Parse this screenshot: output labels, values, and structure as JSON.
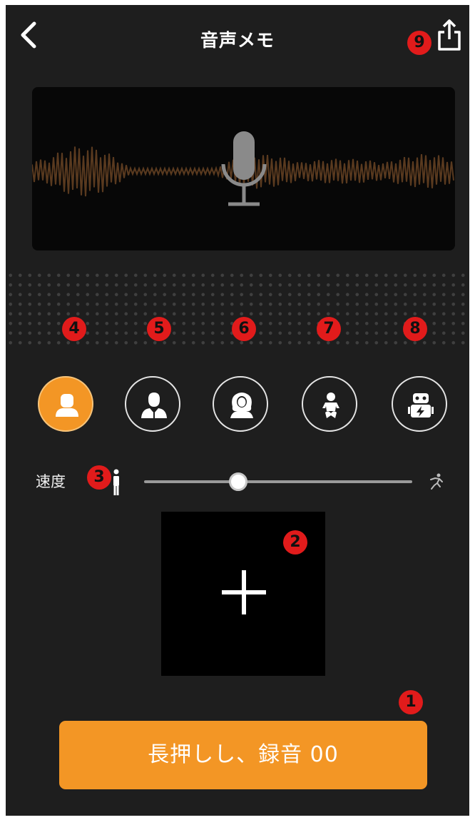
{
  "header": {
    "title": "音声メモ",
    "back_icon": "chevron-left-icon",
    "share_icon": "share-icon"
  },
  "preview": {
    "mic_icon": "microphone-icon",
    "waveform_color": "#5a3a1f",
    "mic_color": "#8a8a8a"
  },
  "annotations": {
    "badge_1": "1",
    "badge_2": "2",
    "badge_3": "3",
    "badge_4": "4",
    "badge_5": "5",
    "badge_6": "6",
    "badge_7": "7",
    "badge_8": "8",
    "badge_9": "9",
    "badge_color": "#e11b1b"
  },
  "voices": [
    {
      "icon": "person-icon",
      "selected": true
    },
    {
      "icon": "man-icon",
      "selected": false
    },
    {
      "icon": "woman-icon",
      "selected": false
    },
    {
      "icon": "baby-icon",
      "selected": false
    },
    {
      "icon": "robot-icon",
      "selected": false
    }
  ],
  "speed": {
    "label": "速度",
    "slow_icon": "walking-person-icon",
    "fast_icon": "running-person-icon",
    "value": 0.35
  },
  "add_box": {
    "icon": "plus-icon"
  },
  "record_button": {
    "label": "長押しし、録音 00"
  },
  "colors": {
    "accent": "#f39625",
    "background": "#1e1e1e"
  }
}
